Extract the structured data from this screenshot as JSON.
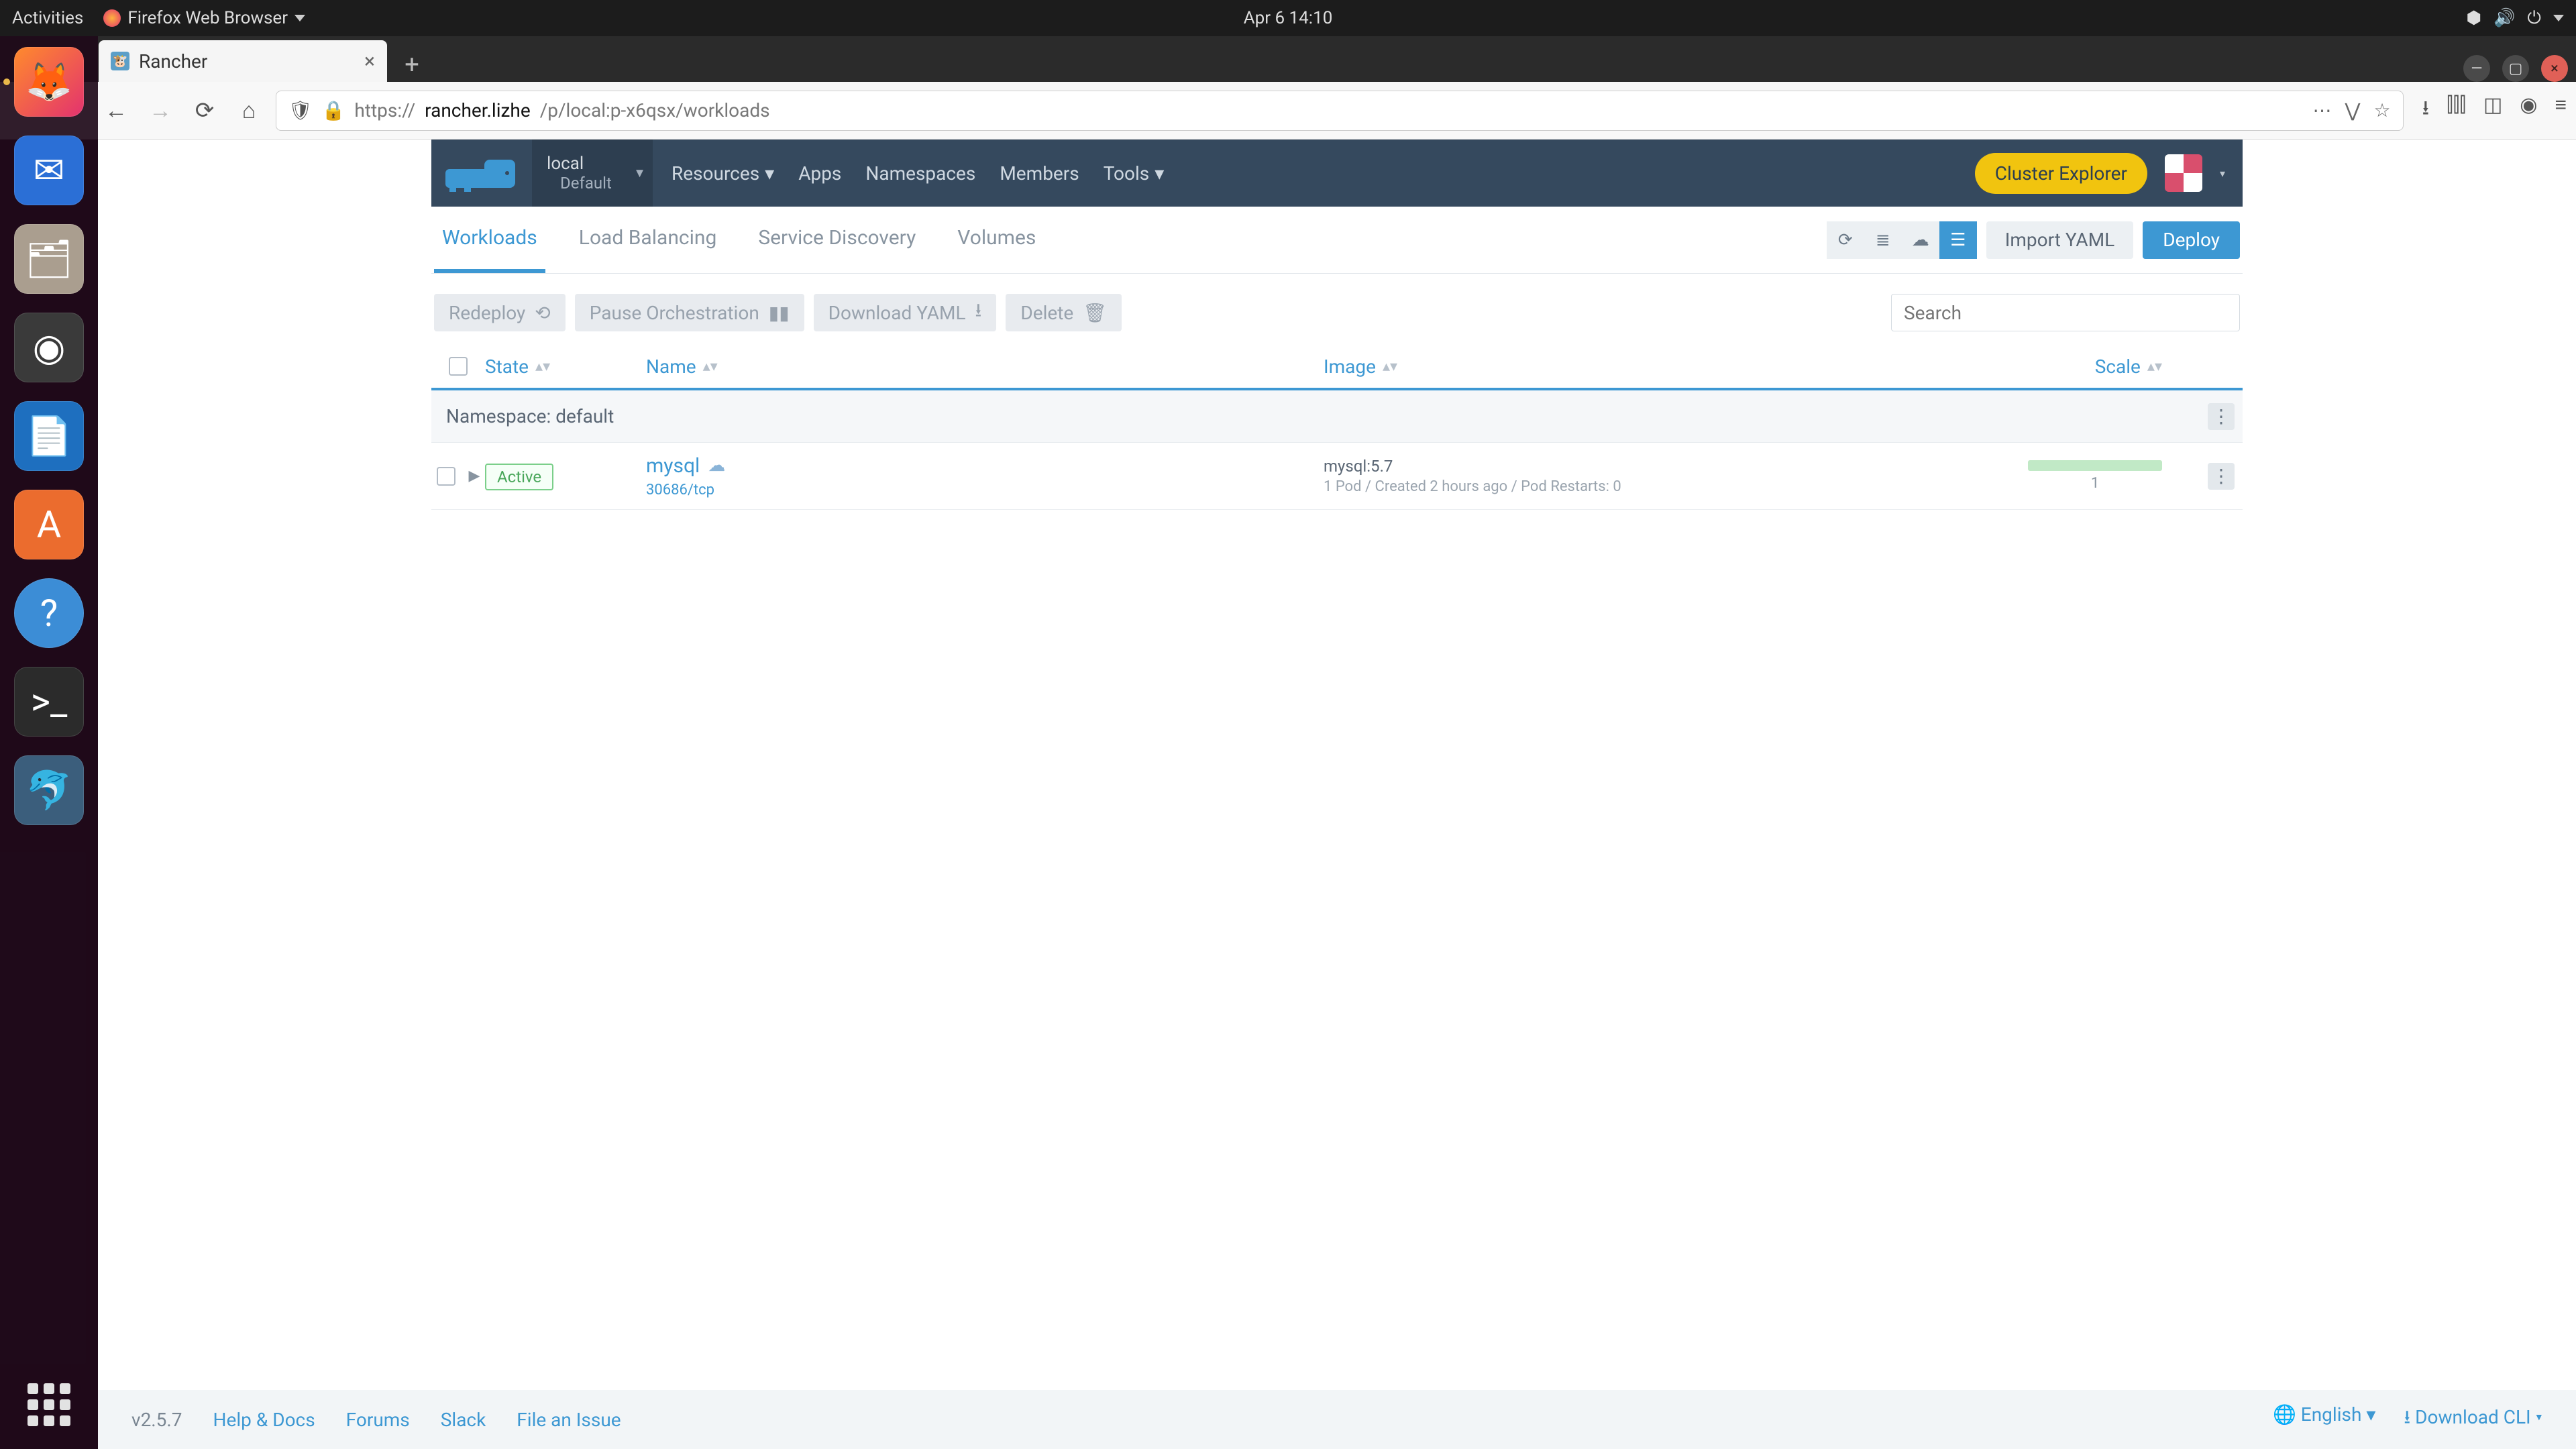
{
  "gnome": {
    "activities": "Activities",
    "browser": "Firefox Web Browser",
    "datetime": "Apr 6  14:10"
  },
  "firefox": {
    "tab_title": "Rancher",
    "url_host": "rancher.lizhe",
    "url_prefix": "https://",
    "url_path": "/p/local:p-x6qsx/workloads"
  },
  "rancher_header": {
    "cluster": "local",
    "project": "Default",
    "nav": {
      "resources": "Resources",
      "apps": "Apps",
      "namespaces": "Namespaces",
      "members": "Members",
      "tools": "Tools"
    },
    "cluster_explorer": "Cluster Explorer"
  },
  "tabs": {
    "workloads": "Workloads",
    "load_balancing": "Load Balancing",
    "service_discovery": "Service Discovery",
    "volumes": "Volumes",
    "import_yaml": "Import YAML",
    "deploy": "Deploy"
  },
  "bulk": {
    "redeploy": "Redeploy",
    "pause": "Pause Orchestration",
    "download": "Download YAML",
    "delete": "Delete",
    "search_placeholder": "Search"
  },
  "columns": {
    "state": "State",
    "name": "Name",
    "image": "Image",
    "scale": "Scale"
  },
  "group": {
    "label": "Namespace: default"
  },
  "row": {
    "state": "Active",
    "name": "mysql",
    "port": "30686/tcp",
    "image": "mysql:5.7",
    "meta": "1 Pod / Created 2 hours ago / Pod Restarts: 0",
    "scale": "1"
  },
  "footer": {
    "version": "v2.5.7",
    "help": "Help & Docs",
    "forums": "Forums",
    "slack": "Slack",
    "file_issue": "File an Issue",
    "english": "English",
    "download_cli": "Download CLI"
  }
}
